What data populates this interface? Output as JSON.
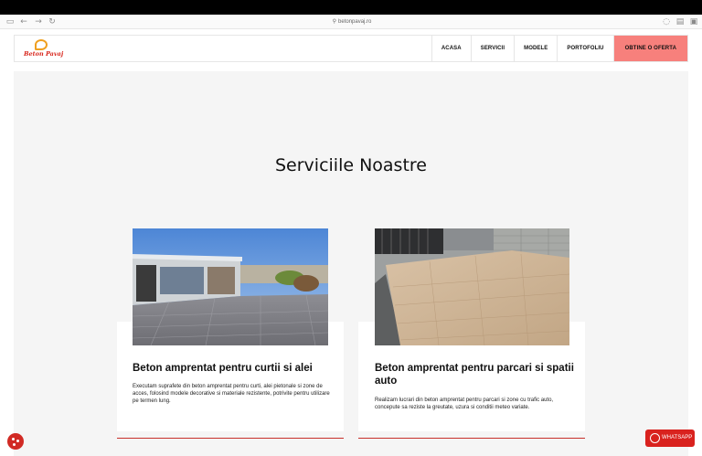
{
  "browser": {
    "url": "betonpavaj.ro"
  },
  "brand": {
    "name": "Beton Pavaj",
    "accent": "#d9221e",
    "cta_bg": "#f7807c"
  },
  "nav": {
    "items": [
      "ACASA",
      "SERVICII",
      "MODELE",
      "PORTOFOLIU"
    ],
    "cta": "OBTINE O OFERTA"
  },
  "section": {
    "title": "Serviciile Noastre"
  },
  "cards": [
    {
      "title": "Beton amprentat pentru curtii si alei",
      "text": "Executam suprafete din beton amprentat pentru curti, alei pietonale si zone de acces, folosind modele decorative si materiale rezistente, potrivite pentru utilizare pe termen lung.",
      "image_icon": "courtyard-photo"
    },
    {
      "title": "Beton amprentat pentru parcari si spatii auto",
      "text": "Realizam lucrari din beton amprentat pentru parcari si zone cu trafic auto, concepute sa reziste la greutate, uzura si conditii meteo variate.",
      "image_icon": "parking-photo"
    }
  ],
  "floating": {
    "whatsapp": "WHATSAPP",
    "cookie_icon": "cookie-icon"
  }
}
